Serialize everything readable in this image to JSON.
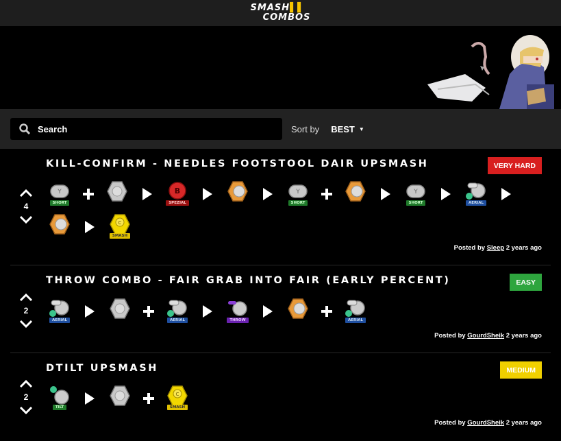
{
  "header": {
    "logo_line1": "SMASH",
    "logo_line2": "COMBOS"
  },
  "search": {
    "placeholder": "Search",
    "value": ""
  },
  "sort": {
    "label": "Sort by",
    "value": "BEST"
  },
  "combos": [
    {
      "title": "KILL-CONFIRM - NEEDLES FOOTSTOOL DAIR UPSMASH",
      "difficulty": "VERY HARD",
      "votes": "4",
      "posted_by_label": "Posted by",
      "author": "Sleep",
      "time": "2 years ago",
      "inputs": [
        "Y SHORT",
        "+",
        "shield",
        ">",
        "B SPEZIAL",
        ">",
        "shield",
        ">",
        "Y SHORT",
        "+",
        "shield",
        ">",
        "Y SHORT",
        ">",
        "A AERIAL",
        ">",
        "shield",
        ">",
        "C SMASH"
      ],
      "tags": [
        "SHORT",
        "SPEZIAL",
        "SHORT",
        "SHORT",
        "AERIAL",
        "SMASH"
      ]
    },
    {
      "title": "THROW COMBO - FAIR GRAB INTO FAIR (EARLY PERCENT)",
      "difficulty": "EASY",
      "votes": "2",
      "posted_by_label": "Posted by",
      "author": "GourdSheik",
      "time": "2 years ago",
      "tags": [
        "AERIAL",
        "AERIAL",
        "THROW",
        "AERIAL"
      ]
    },
    {
      "title": "DTILT UPSMASH",
      "difficulty": "MEDIUM",
      "votes": "2",
      "posted_by_label": "Posted by",
      "author": "GourdSheik",
      "time": "2 years ago",
      "tags": [
        "TILT",
        "SMASH"
      ]
    }
  ],
  "colors": {
    "very_hard": "#d81f1f",
    "easy": "#2ea53e",
    "medium": "#f0d000",
    "accent": "#f5c400"
  }
}
